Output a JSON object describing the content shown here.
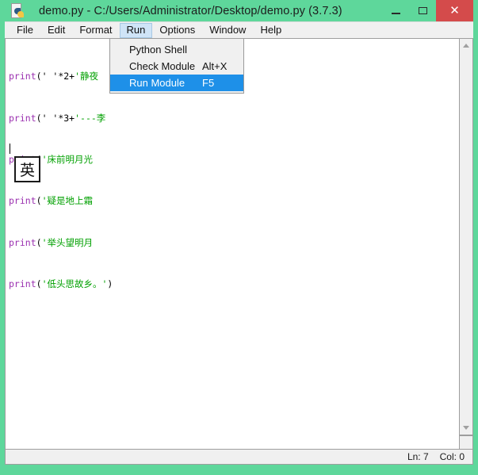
{
  "window": {
    "title": "demo.py - C:/Users/Administrator/Desktop/demo.py (3.7.3)",
    "icon": "python-idle-icon",
    "frame_color": "#5ed79b",
    "caption": {
      "minimize": "–",
      "maximize": "□",
      "close": "✕"
    }
  },
  "menubar": {
    "items": [
      {
        "label": "File",
        "active": false
      },
      {
        "label": "Edit",
        "active": false
      },
      {
        "label": "Format",
        "active": false
      },
      {
        "label": "Run",
        "active": true
      },
      {
        "label": "Options",
        "active": false
      },
      {
        "label": "Window",
        "active": false
      },
      {
        "label": "Help",
        "active": false
      }
    ]
  },
  "dropdown": {
    "owner": "Run",
    "highlight_color": "#1e90e8",
    "items": [
      {
        "label": "Python Shell",
        "accel": "",
        "selected": false
      },
      {
        "label": "Check Module",
        "accel": "Alt+X",
        "selected": false
      },
      {
        "label": "Run Module",
        "accel": "F5",
        "selected": true
      }
    ]
  },
  "editor": {
    "colors": {
      "keyword_function": "#9b30b0",
      "string": "#00a000",
      "plain": "#000000",
      "background": "#ffffff"
    },
    "lines": [
      {
        "n": 1,
        "fn": "print",
        "open": "(",
        "plain_a": "' '*2+",
        "str": "'静夜",
        "tail": ""
      },
      {
        "n": 2,
        "fn": "print",
        "open": "(",
        "plain_a": "' '*3+",
        "str": "'---李",
        "tail": ""
      },
      {
        "n": 3,
        "fn": "print",
        "open": "(",
        "plain_a": "",
        "str": "'床前明月光",
        "tail": ""
      },
      {
        "n": 4,
        "fn": "print",
        "open": "(",
        "plain_a": "",
        "str": "'疑是地上霜",
        "tail": ""
      },
      {
        "n": 5,
        "fn": "print",
        "open": "(",
        "plain_a": "",
        "str": "'举头望明月",
        "tail": ""
      },
      {
        "n": 6,
        "fn": "print",
        "open": "(",
        "plain_a": "",
        "str": "'低头思故乡。'",
        "tail": ")"
      }
    ],
    "caret_line": 7,
    "ime_indicator": "英"
  },
  "scrollbars": {
    "vertical_up": "scroll-up-arrow",
    "vertical_down": "scroll-down-arrow"
  },
  "statusbar": {
    "line": "Ln: 7",
    "col": "Col: 0"
  }
}
